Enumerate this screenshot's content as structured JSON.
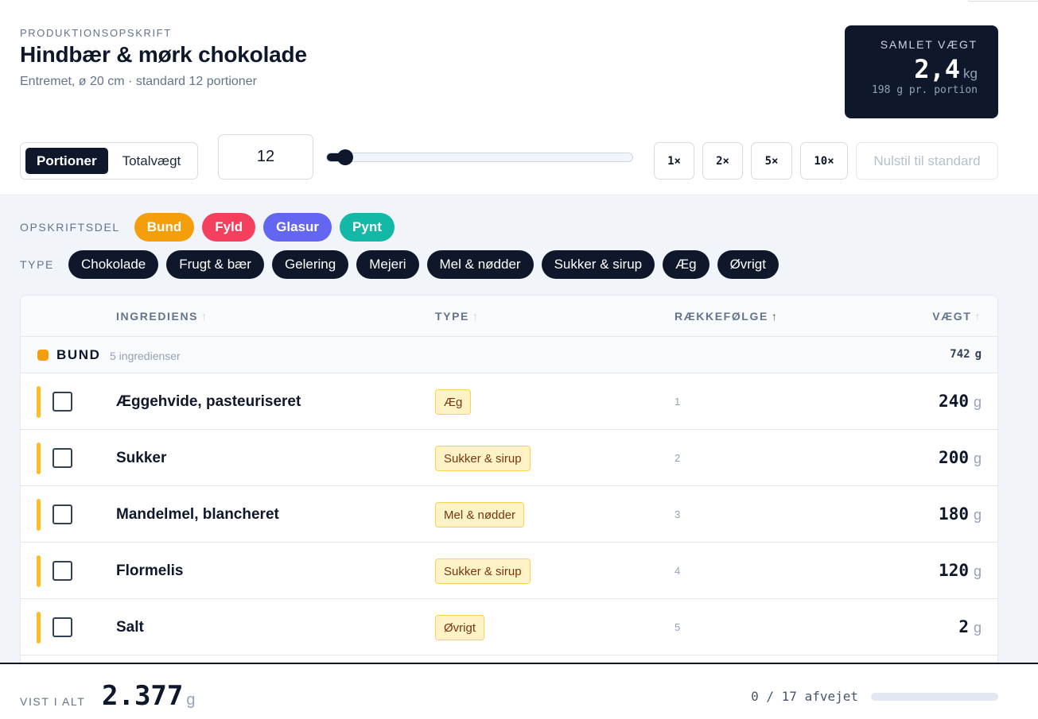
{
  "header": {
    "eyebrow": "PRODUKTIONSOPSKRIFT",
    "title": "Hindbær & mørk chokolade",
    "subtitle": "Entremet, ø 20 cm · standard 12 portioner"
  },
  "summary": {
    "label": "SAMLET VÆGT",
    "value": "2,4",
    "unit": "kg",
    "per_portion": "198 g pr. portion"
  },
  "controls": {
    "modes": [
      "Portioner",
      "Totalvægt"
    ],
    "active_mode": "Portioner",
    "portions_value": "12",
    "slider_fraction": 0.06,
    "multipliers": [
      "1×",
      "2×",
      "5×",
      "10×"
    ],
    "reset_label": "Nulstil til standard"
  },
  "filters": {
    "part_label": "OPSKRIFTSDEL",
    "parts": [
      {
        "label": "Bund",
        "color": "#f59e0b"
      },
      {
        "label": "Fyld",
        "color": "#f43f5e"
      },
      {
        "label": "Glasur",
        "color": "#6366f1"
      },
      {
        "label": "Pynt",
        "color": "#14b8a6"
      }
    ],
    "type_label": "TYPE",
    "types": [
      "Chokolade",
      "Frugt & bær",
      "Gelering",
      "Mejeri",
      "Mel & nødder",
      "Sukker & sirup",
      "Æg",
      "Øvrigt"
    ]
  },
  "table": {
    "columns": {
      "ingredient": "INGREDIENS",
      "type": "TYPE",
      "order": "RÆKKEFØLGE",
      "weight": "VÆGT",
      "sort_arrow_inactive": "↑",
      "sort_arrow_active": "↑"
    },
    "group": {
      "name": "BUND",
      "count": "5 ingredienser",
      "weight": "742",
      "unit": "g",
      "color": "#f59e0b"
    },
    "rows": [
      {
        "name": "Æggehvide, pasteuriseret",
        "type": "Æg",
        "order": "1",
        "weight": "240",
        "unit": "g"
      },
      {
        "name": "Sukker",
        "type": "Sukker & sirup",
        "order": "2",
        "weight": "200",
        "unit": "g"
      },
      {
        "name": "Mandelmel, blancheret",
        "type": "Mel & nødder",
        "order": "3",
        "weight": "180",
        "unit": "g"
      },
      {
        "name": "Flormelis",
        "type": "Sukker & sirup",
        "order": "4",
        "weight": "120",
        "unit": "g"
      },
      {
        "name": "Salt",
        "type": "Øvrigt",
        "order": "5",
        "weight": "2",
        "unit": "g"
      }
    ]
  },
  "footer": {
    "label": "VIST I ALT",
    "total": "2.377",
    "unit": "g",
    "progress_text": "0 / 17 afvejet",
    "progress_fraction": 0
  }
}
